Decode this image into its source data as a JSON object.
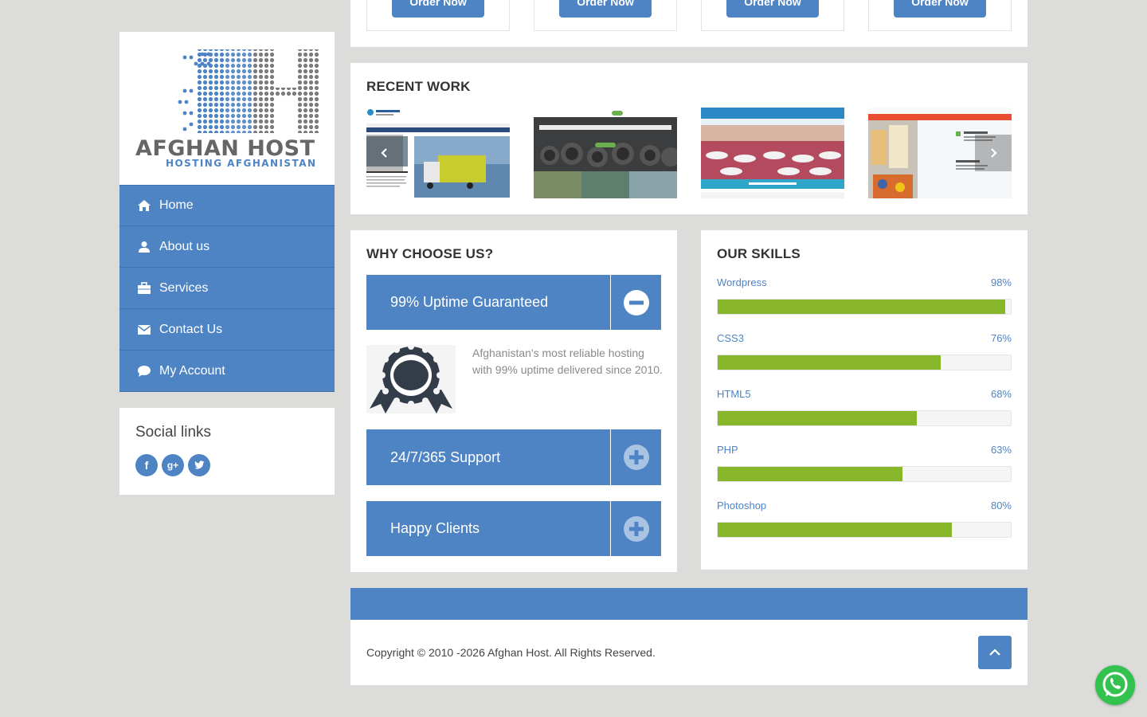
{
  "logo": {
    "brand": "AFGHAN HOST",
    "tagline": "HOSTING AFGHANISTAN"
  },
  "nav": {
    "items": [
      {
        "label": "Home",
        "icon": "home-icon"
      },
      {
        "label": "About us",
        "icon": "user-icon"
      },
      {
        "label": "Services",
        "icon": "briefcase-icon"
      },
      {
        "label": "Contact Us",
        "icon": "envelope-icon"
      },
      {
        "label": "My Account",
        "icon": "comment-icon"
      }
    ]
  },
  "social": {
    "title": "Social links",
    "links": [
      {
        "glyph": "f",
        "icon": "facebook-icon"
      },
      {
        "glyph": "g+",
        "icon": "google-plus-icon"
      },
      {
        "glyph": "t",
        "icon": "twitter-icon"
      }
    ]
  },
  "pricing": {
    "order_label": "Order Now"
  },
  "recent_work": {
    "title": "RECENT WORK",
    "thumbs": [
      {
        "caption": "Sharq Omar Fadi Logistics Company"
      },
      {
        "caption": "WE HOLD A PROMISE OF STRENGTHENING AFGHANISTAN"
      },
      {
        "caption": ""
      },
      {
        "caption": ""
      }
    ]
  },
  "why": {
    "title": "WHY CHOOSE US?",
    "items": [
      {
        "label": "99% Uptime Guaranteed",
        "expanded": true
      },
      {
        "label": "24/7/365 Support",
        "expanded": false
      },
      {
        "label": "Happy Clients",
        "expanded": false
      }
    ],
    "body_text": "Afghanistan's most reliable hosting with 99% uptime delivered since 2010."
  },
  "skills": {
    "title": "OUR SKILLS",
    "items": [
      {
        "name": "Wordpress",
        "label": "98%",
        "value": 98
      },
      {
        "name": "CSS3",
        "label": "76%",
        "value": 76
      },
      {
        "name": "HTML5",
        "label": "68%",
        "value": 68
      },
      {
        "name": "PHP",
        "label": "63%",
        "value": 63
      },
      {
        "name": "Photoshop",
        "label": "80%",
        "value": 80
      }
    ]
  },
  "footer": {
    "copyright": "Copyright © 2010 -2026 Afghan Host. All Rights Reserved."
  },
  "colors": {
    "accent": "#4e84c4",
    "skill_fill": "#88b62b",
    "background": "#dcdddb",
    "whatsapp": "#33c24d"
  }
}
